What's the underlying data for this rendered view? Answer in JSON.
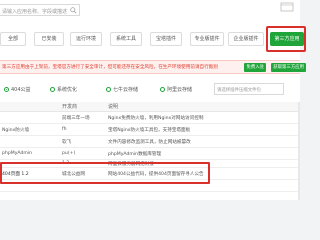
{
  "search": {
    "placeholder": "请输入应用名称、字段或描述"
  },
  "tabs": [
    {
      "label": "全部"
    },
    {
      "label": "已安装"
    },
    {
      "label": "运行环境"
    },
    {
      "label": "系统工具"
    },
    {
      "label": "宝塔插件"
    },
    {
      "label": "专业版插件"
    },
    {
      "label": "企业版插件"
    },
    {
      "label": "第三方应用"
    }
  ],
  "warning": {
    "text": "第三方应用由于上架前，宝塔官方进行了安全审计，但可能还存在安全风险，在生产环境使用前请自行甄别",
    "button1": "免费入驻",
    "button2": "获取第三方应用"
  },
  "filters": [
    {
      "label": "404公益",
      "checked": true
    },
    {
      "label": "系统优化",
      "checked": false
    },
    {
      "label": "七牛云存储",
      "checked": false
    },
    {
      "label": "阿里云存储",
      "checked": false
    }
  ],
  "file_input_placeholder": "请选择插件压缩文件包",
  "table": {
    "headers": [
      "",
      "开发商",
      "说明",
      ""
    ],
    "rows": [
      [
        "",
        "前端三年一场",
        "Nginx免费防火墙，利用Nginx对网站访问控制",
        ""
      ],
      [
        "Nginx防火墙",
        "fh",
        "宝塔Nginx防火墙工具包，支持宝塔面板",
        ""
      ],
      [
        "",
        "软飞",
        "文件内容修改监测工具，防止网站被篡改",
        ""
      ],
      [
        "phpMyAdmin",
        "pu(+)",
        "phpMyAdmin数据库管理",
        ""
      ],
      [
        "",
        "1.2",
        "阿里云服务器网络对接",
        ""
      ],
      [
        "404页面 1.2",
        "城北公益网",
        "网站404公益代码，提供404页面留存寻人公告",
        ""
      ],
      [
        "",
        "",
        "",
        ""
      ]
    ]
  }
}
